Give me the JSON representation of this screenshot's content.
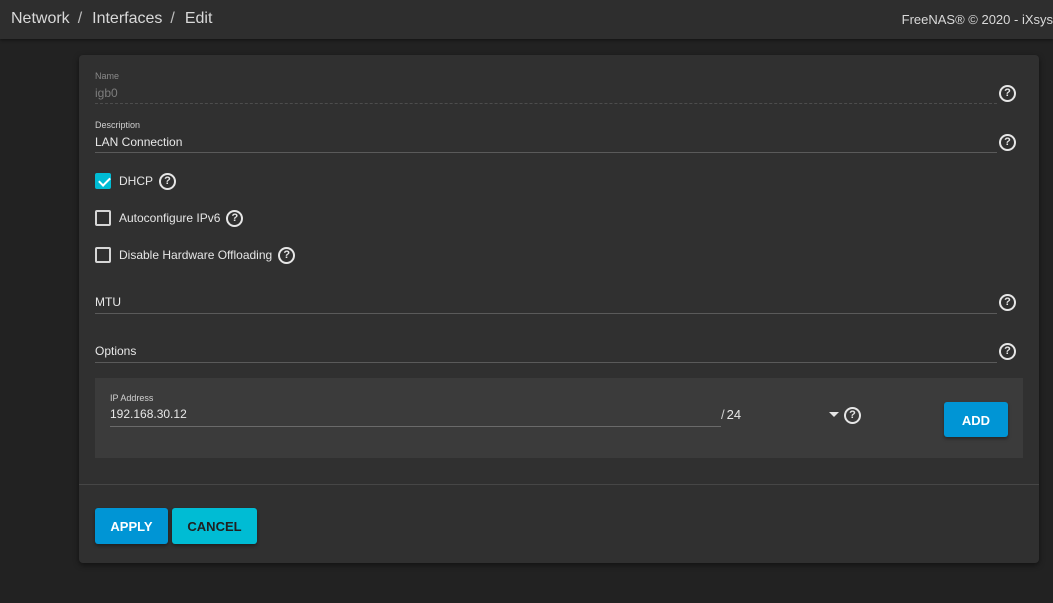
{
  "breadcrumb": {
    "items": [
      "Network",
      "Interfaces",
      "Edit"
    ],
    "separator": "/"
  },
  "header": {
    "copyright": "FreeNAS® © 2020 - iXsys"
  },
  "form": {
    "name": {
      "label": "Name",
      "value": "igb0",
      "disabled": true
    },
    "description": {
      "label": "Description",
      "value": "LAN Connection"
    },
    "dhcp": {
      "label": "DHCP",
      "checked": true
    },
    "autoconfigure_ipv6": {
      "label": "Autoconfigure IPv6",
      "checked": false
    },
    "disable_hw_offloading": {
      "label": "Disable Hardware Offloading",
      "checked": false
    },
    "mtu": {
      "label": "MTU",
      "value": ""
    },
    "options": {
      "label": "Options",
      "value": ""
    },
    "ip": {
      "label": "IP Address",
      "value": "192.168.30.12",
      "netmask_prefix": "/",
      "netmask": "24",
      "add_label": "ADD"
    }
  },
  "actions": {
    "apply_label": "APPLY",
    "cancel_label": "CANCEL"
  },
  "icons": {
    "help": "help-circle-icon",
    "dropdown": "caret-down-icon",
    "check": "check-icon"
  },
  "colors": {
    "background": "#222222",
    "card": "#303030",
    "primary": "#0095d5",
    "accent": "#00bcd4"
  }
}
